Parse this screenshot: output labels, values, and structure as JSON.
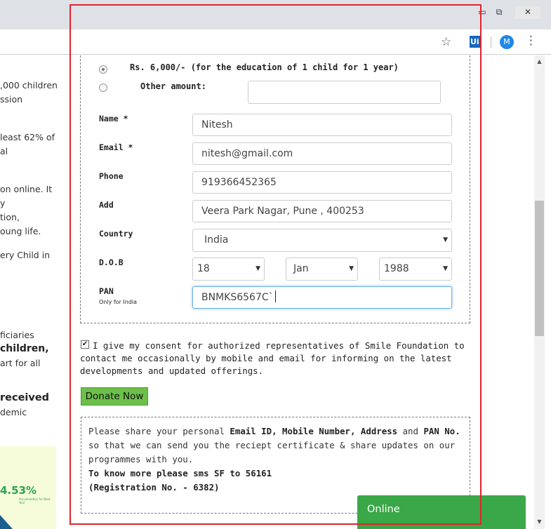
{
  "browser": {
    "window_controls": {
      "minimize": "▭",
      "restore": "⧉",
      "close": "✕"
    },
    "bookmark_icon": "star-icon",
    "extension_label": "Ui",
    "profile_initial": "M",
    "menu_icon": "⋮"
  },
  "background_page": {
    "lines": [
      ",000 children",
      "ssion",
      "least 62% of",
      "al",
      "on online. It",
      "y",
      "tion,",
      "oung life.",
      "ery Child in",
      "ficiaries",
      "children,",
      "art for all",
      "received",
      "demic"
    ],
    "promo_percent": "4.53%",
    "promo_sub": "Accumulation for Next Year"
  },
  "form": {
    "amount_options": [
      {
        "label": "Rs. 6,000/- (for the education of 1 child for 1 year)",
        "selected": true
      },
      {
        "label": "Other amount:",
        "selected": false
      }
    ],
    "other_amount_value": "",
    "fields": {
      "name": {
        "label": "Name *",
        "value": "Nitesh"
      },
      "email": {
        "label": "Email *",
        "value": "nitesh@gmail.com"
      },
      "phone": {
        "label": "Phone",
        "value": "919366452365"
      },
      "add": {
        "label": "Add",
        "value": "Veera Park Nagar, Pune , 400253"
      },
      "country": {
        "label": "Country",
        "value": "India"
      },
      "dob": {
        "label": "D.O.B",
        "day": "18",
        "month": "Jan",
        "year": "1988"
      },
      "pan": {
        "label": "PAN",
        "sublabel": "Only for India",
        "value": "BNMKS6567C`"
      }
    }
  },
  "consent": {
    "checked": true,
    "text": "I give my consent for authorized representatives of Smile Foundation to contact me occasionally by mobile and email for informing on the latest developments and updated offerings."
  },
  "donate_button": "Donate Now",
  "info": {
    "p1_a": "Please share your personal ",
    "p1_b": "Email ID, Mobile Number, Address",
    "p1_c": " and ",
    "p1_d": "PAN No.",
    "p1_e": " so that we can send you the reciept certificate & share updates on our programmes with you.",
    "sms": "To know more please sms SF to 56161",
    "registration": "(Registration No. - 6382)"
  },
  "chat": {
    "label": "Online"
  },
  "colors": {
    "accent_green": "#6cc04a",
    "chat_green": "#3aa848",
    "annotation_red": "#e2232a"
  }
}
